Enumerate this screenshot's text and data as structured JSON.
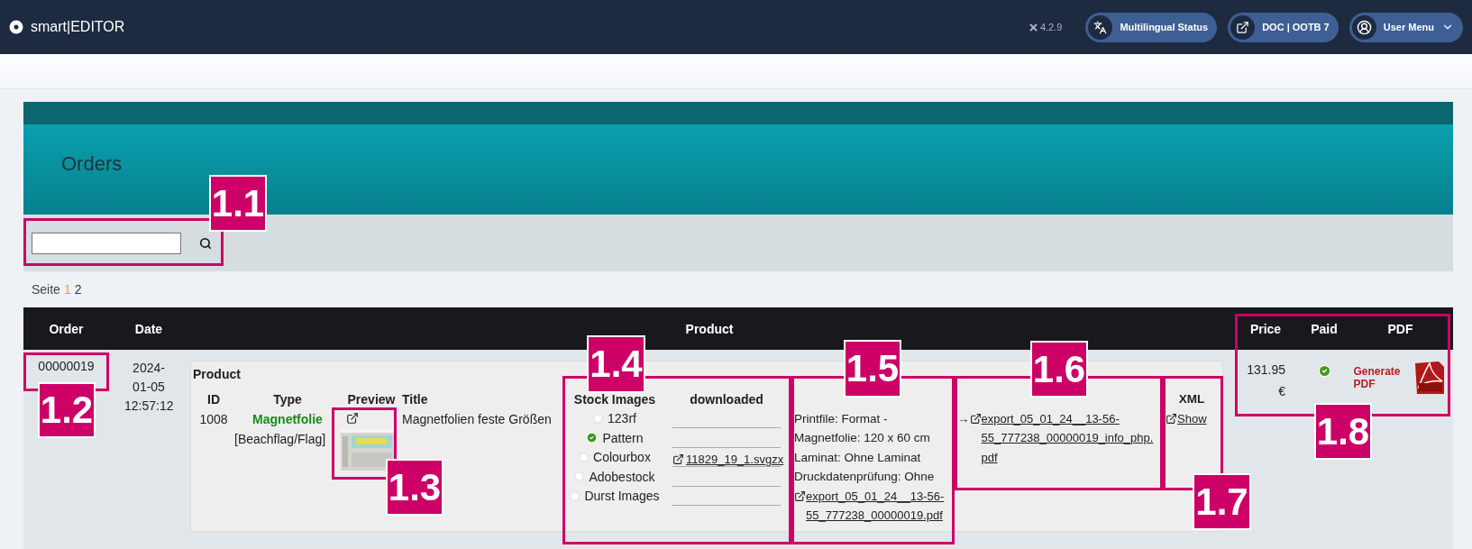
{
  "header": {
    "brand": "smart|EDITOR",
    "version": "4.2.9",
    "buttons": [
      {
        "label": "Multilingual Status",
        "kind": "language"
      },
      {
        "label": "DOC | OOTB 7",
        "kind": "external"
      },
      {
        "label": "User Menu",
        "kind": "user"
      }
    ]
  },
  "page": {
    "title": "Orders"
  },
  "pagination": {
    "label": "Seite",
    "pages": [
      {
        "label": "1",
        "selected": true
      },
      {
        "label": "2",
        "selected": false
      }
    ]
  },
  "table": {
    "columns": [
      "Order",
      "Date",
      "Product",
      "Price",
      "Paid",
      "PDF"
    ],
    "rows": [
      {
        "order": "00000019",
        "date": "2024-01-05 12:57:12",
        "product": {
          "heading": "Product",
          "columns": [
            "ID",
            "Type",
            "Preview",
            "Title"
          ],
          "id": "1008",
          "type": "Magnetfolie",
          "type_detail": "[Beachflag/Flag]",
          "title": "Magnetfolien feste Größen",
          "stock": {
            "columns": [
              "Stock Images",
              "downloaded"
            ],
            "sources": [
              {
                "name": "123rf",
                "downloaded": false
              },
              {
                "name": "Pattern",
                "downloaded": true
              },
              {
                "name": "Colourbox",
                "downloaded": false,
                "file": "11829_19_1.svgzx"
              },
              {
                "name": "Adobestock",
                "downloaded": false
              },
              {
                "name": "Durst Images",
                "downloaded": false
              }
            ]
          },
          "printfile": {
            "lines": [
              "Printfile: Format - Magnetfolie: 120 x 60 cm",
              "Laminat: Ohne Laminat",
              "Druckdatenprüfung: Ohne"
            ],
            "link": "export_05_01_24__13-56-55_777238_00000019.pdf"
          },
          "info": {
            "arrow": "→",
            "link": "export_05_01_24__13-56-55_777238_00000019_info_php.pdf"
          },
          "xml": {
            "heading": "XML",
            "link": "Show"
          }
        },
        "price": "131.95 €",
        "paid": true,
        "pdf": {
          "label": "Generate PDF"
        }
      }
    ]
  },
  "annotations": [
    {
      "label": "1.1"
    },
    {
      "label": "1.2"
    },
    {
      "label": "1.3"
    },
    {
      "label": "1.4"
    },
    {
      "label": "1.5"
    },
    {
      "label": "1.6"
    },
    {
      "label": "1.7"
    },
    {
      "label": "1.8"
    }
  ]
}
